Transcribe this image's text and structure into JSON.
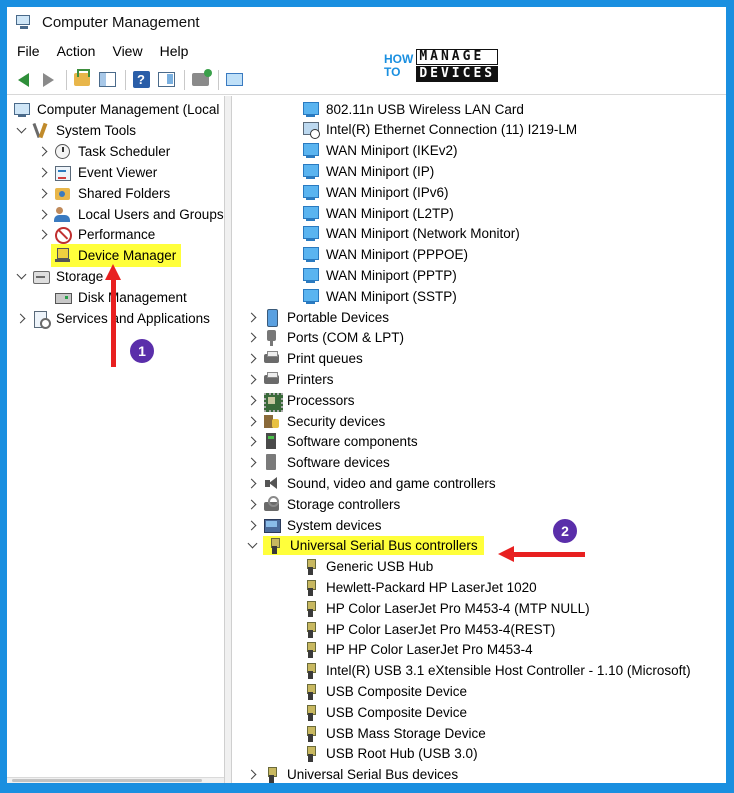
{
  "window": {
    "title": "Computer Management"
  },
  "menu": [
    "File",
    "Action",
    "View",
    "Help"
  ],
  "logo": {
    "left": [
      "HOW",
      "TO"
    ],
    "right": [
      "MANAGE",
      "DEVICES"
    ]
  },
  "left_tree": [
    {
      "label": "Computer Management (Local",
      "icon": "computer-icon"
    },
    {
      "label": "System Tools",
      "icon": "tools-icon"
    },
    {
      "label": "Task Scheduler",
      "icon": "clock-icon"
    },
    {
      "label": "Event Viewer",
      "icon": "event-viewer-icon"
    },
    {
      "label": "Shared Folders",
      "icon": "shared-folder-icon"
    },
    {
      "label": "Local Users and Groups",
      "icon": "users-icon"
    },
    {
      "label": "Performance",
      "icon": "performance-icon"
    },
    {
      "label": "Device Manager",
      "icon": "device-manager-icon"
    },
    {
      "label": "Storage",
      "icon": "storage-icon"
    },
    {
      "label": "Disk Management",
      "icon": "disk-icon"
    },
    {
      "label": "Services and Applications",
      "icon": "services-icon"
    }
  ],
  "right_tree": [
    {
      "label": "802.11n USB Wireless LAN Card"
    },
    {
      "label": "Intel(R) Ethernet Connection (11) I219-LM"
    },
    {
      "label": "WAN Miniport (IKEv2)"
    },
    {
      "label": "WAN Miniport (IP)"
    },
    {
      "label": "WAN Miniport (IPv6)"
    },
    {
      "label": "WAN Miniport (L2TP)"
    },
    {
      "label": "WAN Miniport (Network Monitor)"
    },
    {
      "label": "WAN Miniport (PPPOE)"
    },
    {
      "label": "WAN Miniport (PPTP)"
    },
    {
      "label": "WAN Miniport (SSTP)"
    },
    {
      "label": "Portable Devices"
    },
    {
      "label": "Ports (COM & LPT)"
    },
    {
      "label": "Print queues"
    },
    {
      "label": "Printers"
    },
    {
      "label": "Processors"
    },
    {
      "label": "Security devices"
    },
    {
      "label": "Software components"
    },
    {
      "label": "Software devices"
    },
    {
      "label": "Sound, video and game controllers"
    },
    {
      "label": "Storage controllers"
    },
    {
      "label": "System devices"
    },
    {
      "label": "Universal Serial Bus controllers"
    },
    {
      "label": "Generic USB Hub"
    },
    {
      "label": "Hewlett-Packard HP LaserJet 1020"
    },
    {
      "label": "HP Color LaserJet Pro M453-4 (MTP NULL)"
    },
    {
      "label": "HP Color LaserJet Pro M453-4(REST)"
    },
    {
      "label": "HP HP Color LaserJet Pro M453-4"
    },
    {
      "label": "Intel(R) USB 3.1 eXtensible Host Controller - 1.10 (Microsoft)"
    },
    {
      "label": "USB Composite Device"
    },
    {
      "label": "USB Composite Device"
    },
    {
      "label": "USB Mass Storage Device"
    },
    {
      "label": "USB Root Hub (USB 3.0)"
    },
    {
      "label": "Universal Serial Bus devices"
    }
  ],
  "annotations": {
    "step1": "1",
    "step2": "2"
  },
  "colors": {
    "highlight": "#ffff3b",
    "arrow": "#e82020",
    "badge": "#5a2eaa",
    "frame": "#1a8fe0"
  }
}
